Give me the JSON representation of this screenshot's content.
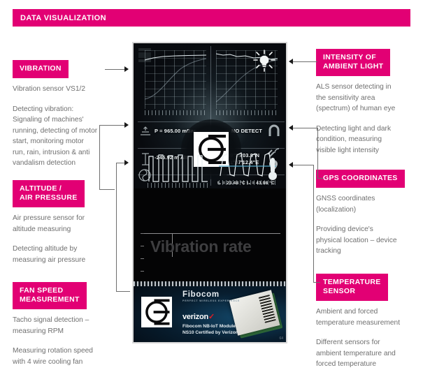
{
  "header": {
    "title": "DATA VISUALIZATION"
  },
  "left_column": [
    {
      "tag_line1": "VIBRATION",
      "tag_line2": "",
      "paragraphs": [
        "Vibration sensor VS1/2",
        "Detecting vibration:\nSignaling of machines'\nrunning, detecting of motor\nstart, monitoring motor\nrun, rain, intrusion & anti\nvandalism detection"
      ]
    },
    {
      "tag_line1": "ALTITUDE /",
      "tag_line2": "AIR PRESSURE",
      "paragraphs": [
        "Air pressure sensor for\naltitude measuring",
        "Detecting altitude by\nmeasuring air pressure"
      ]
    },
    {
      "tag_line1": "FAN SPEED",
      "tag_line2": "MEASUREMENT",
      "paragraphs": [
        "Tacho signal detection –\nmeasuring RPM",
        "Measuring rotation speed\nwith 4 wire cooling fan"
      ]
    }
  ],
  "right_column": [
    {
      "tag_line1": "INTENSITY OF",
      "tag_line2": "AMBIENT LIGHT",
      "paragraphs": [
        "ALS sensor detecting in\nthe sensitivity area\n(spectrum) of human eye",
        "Detecting light and dark\ncondition, measuring\nvisible light intensity"
      ]
    },
    {
      "tag_line1": "GPS COORDINATES",
      "tag_line2": "",
      "paragraphs": [
        "GNSS coordinates\n(localization)",
        "Providing device's\nphysical location – device\ntracking"
      ]
    },
    {
      "tag_line1": "TEMPERATURE",
      "tag_line2": "SENSOR",
      "paragraphs": [
        "Ambient and forced\ntemperature measurement",
        "Different sensors for\nambient temperature and\nforced temperature"
      ]
    }
  ],
  "device": {
    "readouts": {
      "pressure": "P = 965.00 mBar",
      "altitude": "-245.92 m Altitude",
      "detect": "NO DETECT",
      "gps": "49°25'03.8\"N\n11°07'12.4\"E",
      "temperatures": "t₁ = 23.48 °C   t₂ = 43.98 °C"
    },
    "vibration_title": "Vibration rate",
    "board": {
      "brand": "Fibocom",
      "brand_tagline": "PERFECT WIRELESS EXPERIENCE",
      "carrier": "verizon",
      "caption": "Fibocom NB-IoT Module\nNS10 Certified by Verizon",
      "corner_number": "64"
    }
  },
  "colors": {
    "accent": "#e20074",
    "body_text": "#6f6f6f",
    "device_bg": "#0a0a0c"
  }
}
